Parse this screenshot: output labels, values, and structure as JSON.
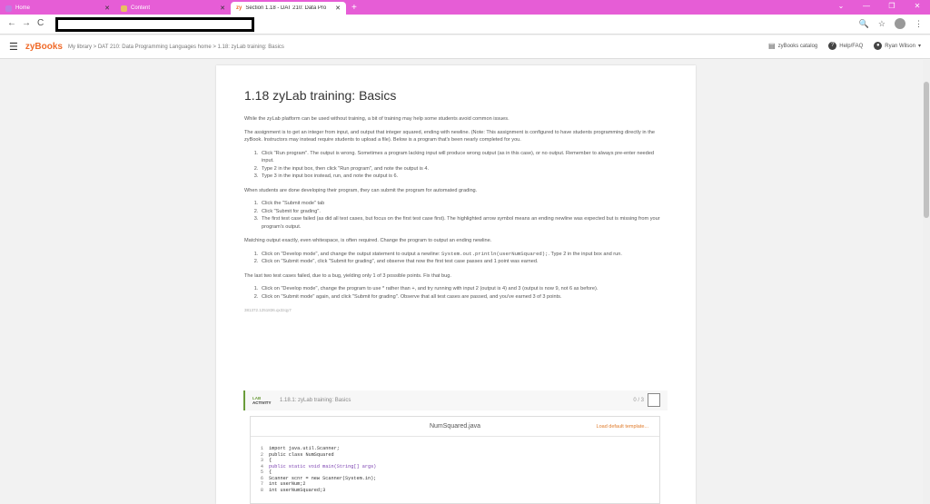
{
  "browser": {
    "tabs": [
      {
        "label": "Home",
        "icon_color": "#c07be0"
      },
      {
        "label": "Content",
        "icon_color": "#e8c060"
      },
      {
        "label": "Section 1.18 - DAT 210: Data Pro",
        "icon_label": "zy"
      }
    ],
    "new_tab": "+",
    "close_glyph": "✕",
    "window_controls": [
      "⌄",
      "—",
      "❐",
      "✕"
    ],
    "nav": {
      "back": "←",
      "forward": "→",
      "reload": "C"
    },
    "addr_icons": [
      "🔍",
      "☆",
      "⋮"
    ]
  },
  "zybar": {
    "brand": "zyBooks",
    "breadcrumb": "My library > DAT 210: Data Programming Languages home > 1.18: zyLab training: Basics",
    "catalog": "zyBooks catalog",
    "help": "Help/FAQ",
    "user": "Ryan Wilson"
  },
  "section": {
    "title": "1.18 zyLab training: Basics",
    "intro1": "While the zyLab platform can be used without training, a bit of training may help some students avoid common issues.",
    "intro2": "The assignment is to get an integer from input, and output that integer squared, ending with newline. (Note: This assignment is configured to have students programming directly in the zyBook. Instructors may instead require students to upload a file). Below is a program that's been nearly completed for you.",
    "list1": [
      "Click \"Run program\". The output is wrong. Sometimes a program lacking input will produce wrong output (as in this case), or no output. Remember to always pre-enter needed input.",
      "Type 2 in the input box, then click \"Run program\", and note the output is 4.",
      "Type 3 in the input box instead, run, and note the output is 6."
    ],
    "para3": "When students are done developing their program, they can submit the program for automated grading.",
    "list2": [
      "Click the \"Submit mode\" tab",
      "Click \"Submit for grading\".",
      "The first test case failed (as did all test cases, but focus on the first test case first). The highlighted arrow symbol means an ending newline was expected but is missing from your program's output."
    ],
    "para4": "Matching output exactly, even whitespace, is often required. Change the program to output an ending newline.",
    "list3_1a": "Click on \"Develop mode\", and change the output statement to output a newline: ",
    "list3_1code": "System.out.println(userNumSquared);",
    "list3_1b": ". Type 2 in the input box and run.",
    "list3_2": "Click on \"Submit mode\", click \"Submit for grading\", and observe that now the first test case passes and 1 point was earned.",
    "para5": "The last two test cases failed, due to a bug, yielding only 1 of 3 possible points. Fix that bug.",
    "list4": [
      "Click on \"Develop mode\", change the program to use * rather than +, and try running with input 2 (output is 4) and 3 (output is now 9, not 6 as before).",
      "Click on \"Submit mode\" again, and click \"Submit for grading\". Observe that all test cases are passed, and you've earned 3 of 3 points."
    ],
    "tiny_id": "381372.1251836.qx3zqy7"
  },
  "lab": {
    "tag_line1": "LAB",
    "tag_line2": "ACTIVITY",
    "title": "1.18.1: zyLab training: Basics",
    "score": "0 / 3",
    "filename": "NumSquared.java",
    "load_template": "Load default template...",
    "code": [
      {
        "n": "1",
        "t": "import java.util.Scanner;"
      },
      {
        "n": "2",
        "t": "public class NumSquared"
      },
      {
        "n": "3",
        "t": "{"
      },
      {
        "n": "4",
        "t": "   public static void main(String[] args)"
      },
      {
        "n": "5",
        "t": "   {"
      },
      {
        "n": "6",
        "t": "   Scanner scnr = new Scanner(System.in);"
      },
      {
        "n": "7",
        "t": "   int userNum;2"
      },
      {
        "n": "8",
        "t": "   int userNumSquared;3"
      }
    ]
  }
}
